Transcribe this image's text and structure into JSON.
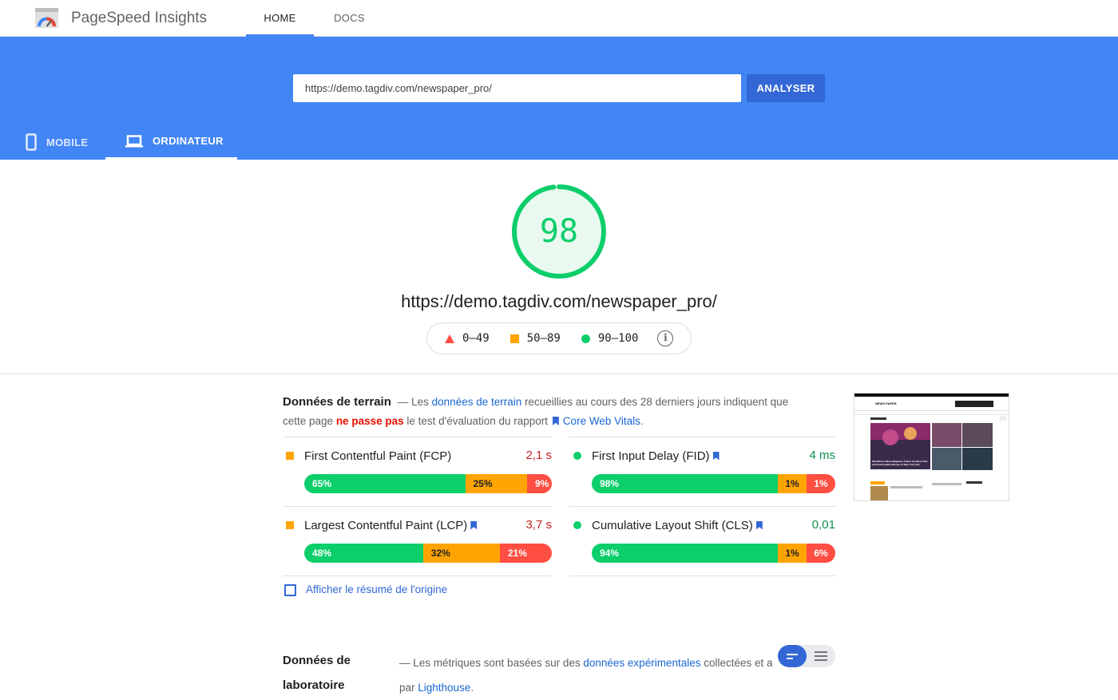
{
  "header": {
    "app_title": "PageSpeed Insights",
    "tabs": [
      {
        "label": "HOME",
        "active": true
      },
      {
        "label": "DOCS",
        "active": false
      }
    ]
  },
  "search": {
    "url_value": "https://demo.tagdiv.com/newspaper_pro/",
    "analyze_label": "ANALYSER"
  },
  "devices": [
    {
      "label": "MOBILE",
      "icon": "smartphone-icon",
      "active": false
    },
    {
      "label": "ORDINATEUR",
      "icon": "laptop-icon",
      "active": true
    }
  ],
  "score": {
    "value": "98",
    "fraction": 0.98,
    "color": "#0cce6b",
    "url": "https://demo.tagdiv.com/newspaper_pro/"
  },
  "legend": [
    {
      "range": "0–49",
      "shape": "triangle",
      "color": "#ff4e42"
    },
    {
      "range": "50–89",
      "shape": "square",
      "color": "#ffa400"
    },
    {
      "range": "90–100",
      "shape": "circle",
      "color": "#0cce6b"
    }
  ],
  "field_data": {
    "title": "Données de terrain",
    "desc_1": "— Les ",
    "desc_link_1": "données de terrain",
    "desc_2": " recueillies au cours des 28 derniers jours indiquent que cette page ",
    "desc_fail": "ne passe pas",
    "desc_3": " le test d'évaluation du rapport ",
    "desc_link_2": "Core Web Vitals",
    "desc_4": ".",
    "metrics": [
      {
        "name": "First Contentful Paint (FCP)",
        "value": "2,1 s",
        "status": "avg",
        "core": false,
        "dist": [
          {
            "label": "65%",
            "pct": 65
          },
          {
            "label": "25%",
            "pct": 25
          },
          {
            "label": "9%",
            "pct": 10
          }
        ]
      },
      {
        "name": "First Input Delay (FID)",
        "value": "4 ms",
        "status": "good",
        "core": true,
        "dist": [
          {
            "label": "98%",
            "pct": 98
          },
          {
            "label": "1%",
            "pct": 1
          },
          {
            "label": "1%",
            "pct": 1
          }
        ]
      },
      {
        "name": "Largest Contentful Paint (LCP)",
        "value": "3,7 s",
        "status": "avg",
        "core": true,
        "dist": [
          {
            "label": "48%",
            "pct": 48
          },
          {
            "label": "32%",
            "pct": 31
          },
          {
            "label": "21%",
            "pct": 21
          }
        ]
      },
      {
        "name": "Cumulative Layout Shift (CLS)",
        "value": "0,01",
        "status": "good",
        "core": true,
        "dist": [
          {
            "label": "94%",
            "pct": 94
          },
          {
            "label": "1%",
            "pct": 1
          },
          {
            "label": "6%",
            "pct": 5
          }
        ]
      }
    ],
    "origin_summary_label": "Afficher le résumé de l'origine"
  },
  "lab_data": {
    "title": "Données de laboratoire",
    "desc_1": "— Les métriques sont basées sur des ",
    "desc_link_1": "données expérimentales",
    "desc_2": " collectées et a",
    "desc_3": "par ",
    "desc_link_2": "Lighthouse",
    "desc_4": "."
  },
  "thumbnail": {
    "site_name": "NEWS PAPER",
    "headline": "WordPress News Magazine Charts the Most Chic and Fashionable Women of New York City"
  }
}
